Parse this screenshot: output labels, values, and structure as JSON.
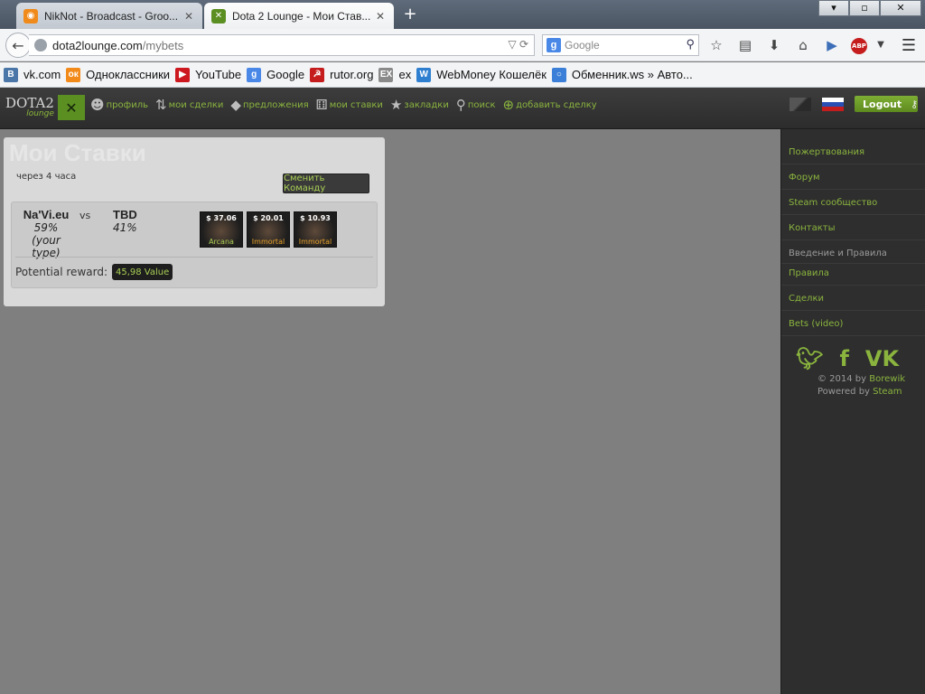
{
  "browser": {
    "tabs": [
      {
        "title": "NikNot - Broadcast - Groo...",
        "active": false
      },
      {
        "title": "Dota 2 Lounge - Мои Став...",
        "active": true
      }
    ],
    "url_host": "dota2lounge.com",
    "url_path": "/mybets",
    "search_placeholder": "Google",
    "abp_label": "ABP",
    "window_close_glyph": "✕",
    "bookmarks": [
      {
        "label": "vk.com",
        "icon": "vk-icon",
        "glyph": "B",
        "color": "#4a76a8"
      },
      {
        "label": "Одноклассники",
        "icon": "odnoklassniki-icon",
        "glyph": "ок",
        "color": "#f28a1a"
      },
      {
        "label": "YouTube",
        "icon": "youtube-icon",
        "glyph": "▶",
        "color": "#cc181e"
      },
      {
        "label": "Google",
        "icon": "google-icon",
        "glyph": "g",
        "color": "#4a88e8"
      },
      {
        "label": "rutor.org",
        "icon": "rutor-icon",
        "glyph": "☭",
        "color": "#c51d1d"
      },
      {
        "label": "ex",
        "icon": "ex-icon",
        "glyph": "EX",
        "color": "#8a8a8a"
      },
      {
        "label": "WebMoney Кошелёк",
        "icon": "webmoney-icon",
        "glyph": "W",
        "color": "#2f7fd1"
      },
      {
        "label": "Обменник.ws » Авто...",
        "icon": "exchange-icon",
        "glyph": "○",
        "color": "#3b7fd8"
      }
    ]
  },
  "site": {
    "logo_text": "DOTA2",
    "logo_sub": "lounge",
    "menu": [
      {
        "label": "профиль",
        "icon": "profile-icon",
        "glyph": "☻"
      },
      {
        "label": "мои сделки",
        "icon": "trades-icon",
        "glyph": "⇅"
      },
      {
        "label": "предложения",
        "icon": "tag-icon",
        "glyph": "◆"
      },
      {
        "label": "мои ставки",
        "icon": "dice-icon",
        "glyph": "⚅"
      },
      {
        "label": "закладки",
        "icon": "star-icon",
        "glyph": "★"
      },
      {
        "label": "поиск",
        "icon": "search-icon",
        "glyph": "⚲"
      },
      {
        "label": "добавить сделку",
        "icon": "plus-icon",
        "glyph": "⊕"
      }
    ],
    "logout_label": "Logout"
  },
  "bets": {
    "title": "Мои Ставки",
    "time_label": "через 4 часа",
    "change_team_label": "Сменить Команду",
    "team1": {
      "name": "Na'Vi.eu",
      "pct": "59%",
      "note": "(your type)"
    },
    "vs_label": "vs",
    "team2": {
      "name": "TBD",
      "pct": "41%"
    },
    "items": [
      {
        "price": "$ 37.06",
        "rarity": "Arcana",
        "color": "#a9cf55"
      },
      {
        "price": "$ 20.01",
        "rarity": "Immortal",
        "color": "#e6a12a"
      },
      {
        "price": "$ 10.93",
        "rarity": "Immortal",
        "color": "#e6a12a"
      }
    ],
    "reward_label": "Potential reward:",
    "reward_value": "45,98 Value"
  },
  "sidebar": {
    "links_top": [
      "Пожертвования",
      "Форум",
      "Steam сообщество",
      "Контакты"
    ],
    "rules_head": "Введение и Правила",
    "links_bottom": [
      "Правила",
      "Сделки",
      "Bets (video)"
    ],
    "copyright_prefix": "© 2014 by",
    "copyright_author": "Borewik",
    "powered_prefix": "Powered by",
    "powered_by": "Steam"
  },
  "colors": {
    "accent_green": "#8ab43e",
    "header_bg": "#333333",
    "page_bg": "#7f7f7f"
  }
}
